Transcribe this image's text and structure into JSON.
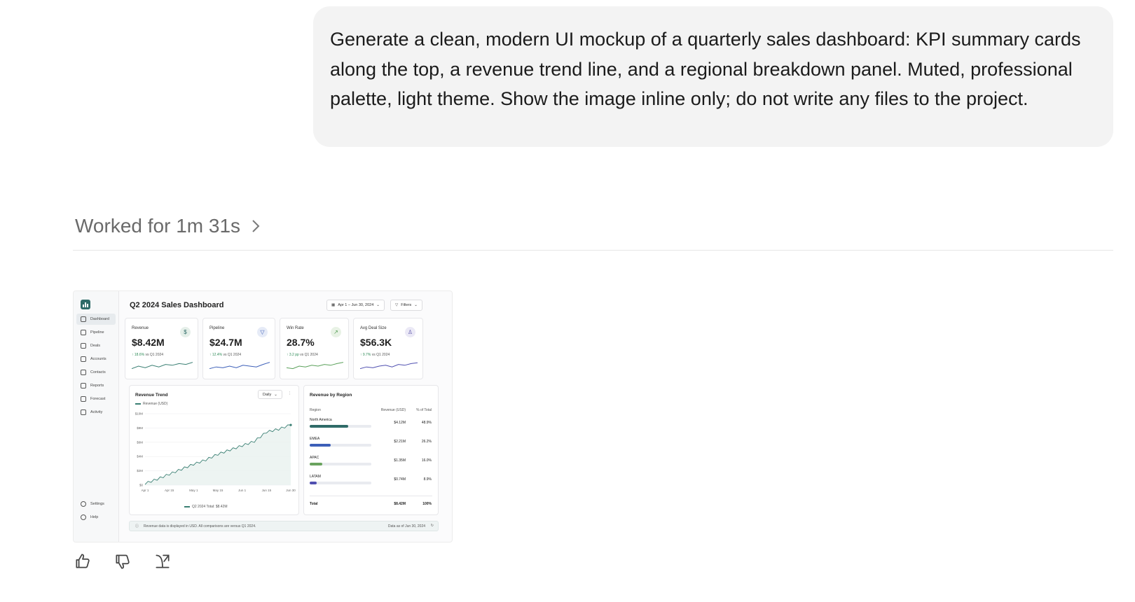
{
  "user_message": "Generate a clean, modern UI mockup of a quarterly sales dashboard: KPI summary cards along the top, a revenue trend line, and a regional breakdown panel. Muted, professional palette, light theme. Show the image inline only; do not write any files to the project.",
  "worked_label": "Worked for 1m 31s",
  "dashboard": {
    "title": "Q2 2024 Sales Dashboard",
    "date_range": "Apr 1 – Jun 30, 2024",
    "filters_label": "Filters",
    "nav": [
      {
        "label": "Dashboard",
        "icon": "grid-icon",
        "active": true
      },
      {
        "label": "Pipeline",
        "icon": "filter-icon"
      },
      {
        "label": "Deals",
        "icon": "tray-icon"
      },
      {
        "label": "Accounts",
        "icon": "building-icon"
      },
      {
        "label": "Contacts",
        "icon": "person-icon"
      },
      {
        "label": "Reports",
        "icon": "bar-chart-icon"
      },
      {
        "label": "Forecast",
        "icon": "trend-icon"
      },
      {
        "label": "Activity",
        "icon": "pulse-icon"
      }
    ],
    "nav_bottom": [
      {
        "label": "Settings",
        "icon": "gear-icon"
      },
      {
        "label": "Help",
        "icon": "help-icon"
      }
    ],
    "kpis": [
      {
        "label": "Revenue",
        "value": "$8.42M",
        "delta": "18.6%",
        "compare": "vs Q1 2024",
        "badge": "$",
        "badge_color": "#e5efe9",
        "badge_fg": "#2f6b68",
        "spark_color": "#3a7f73"
      },
      {
        "label": "Pipeline",
        "value": "$24.7M",
        "delta": "12.4%",
        "compare": "vs Q1 2024",
        "badge": "▽",
        "badge_color": "#e6ebf7",
        "badge_fg": "#3c5fb8",
        "spark_color": "#3c5fb8"
      },
      {
        "label": "Win Rate",
        "value": "28.7%",
        "delta": "3.2 pp",
        "compare": "vs Q1 2024",
        "badge": "↗",
        "badge_color": "#e8f2e5",
        "badge_fg": "#4f9a4f",
        "spark_color": "#5aa05a"
      },
      {
        "label": "Avg Deal Size",
        "value": "$56.3K",
        "delta": "9.7%",
        "compare": "vs Q1 2024",
        "badge": "♙",
        "badge_color": "#ebe9f6",
        "badge_fg": "#5a53a8",
        "spark_color": "#4f4fb0"
      }
    ],
    "trend": {
      "title": "Revenue Trend",
      "period": "Daily",
      "legend": "Revenue (USD)",
      "total_caption": "Q2 2024 Total: $8.42M",
      "color": "#3a7f73"
    },
    "regions": {
      "title": "Revenue by Region",
      "col_region": "Region",
      "col_revenue": "Revenue (USD)",
      "col_pct": "% of Total",
      "rows": [
        {
          "name": "North America",
          "revenue": "$4.12M",
          "pct": "48.9%",
          "share": 0.489,
          "color": "#2f6b68"
        },
        {
          "name": "EMEA",
          "revenue": "$2.21M",
          "pct": "26.2%",
          "share": 0.262,
          "color": "#3c5fb8"
        },
        {
          "name": "APAC",
          "revenue": "$1.35M",
          "pct": "16.0%",
          "share": 0.16,
          "color": "#6aa35e"
        },
        {
          "name": "LATAM",
          "revenue": "$0.74M",
          "pct": "8.9%",
          "share": 0.089,
          "color": "#4f4fb0"
        }
      ],
      "total_label": "Total",
      "total_revenue": "$8.42M",
      "total_pct": "100%"
    },
    "footer_note": "Revenue data is displayed in USD. All comparisons are versus Q1 2024.",
    "footer_asof": "Data as of Jun 30, 2024"
  },
  "chart_data": {
    "type": "line",
    "title": "Revenue Trend",
    "ylabel": "",
    "xlabel": "",
    "x_ticks": [
      "Apr 1",
      "Apr 15",
      "May 1",
      "May 15",
      "Jun 1",
      "Jun 15",
      "Jun 30"
    ],
    "y_ticks": [
      "$0",
      "$2M",
      "$4M",
      "$6M",
      "$8M",
      "$10M"
    ],
    "ylim": [
      0,
      10
    ],
    "series": [
      {
        "name": "Revenue (USD)",
        "x": [
          "Apr 1",
          "Apr 8",
          "Apr 15",
          "Apr 22",
          "May 1",
          "May 8",
          "May 15",
          "May 22",
          "Jun 1",
          "Jun 8",
          "Jun 15",
          "Jun 22",
          "Jun 30"
        ],
        "values": [
          0.2,
          0.8,
          1.5,
          2.2,
          2.9,
          3.5,
          4.3,
          4.9,
          5.5,
          6.1,
          7.4,
          7.8,
          8.42
        ]
      }
    ],
    "grid": true,
    "legend": "top-left"
  }
}
